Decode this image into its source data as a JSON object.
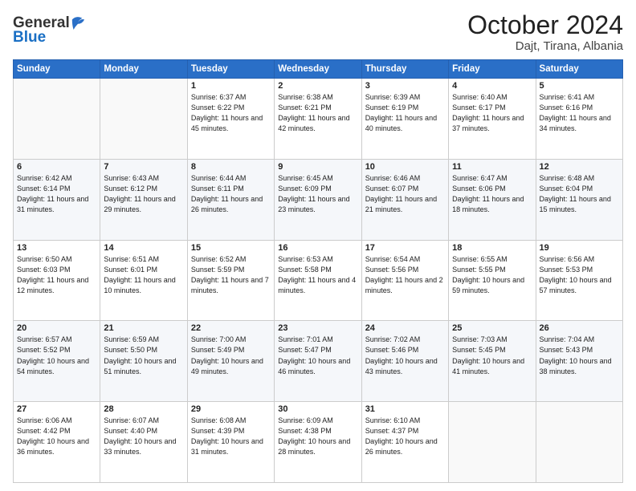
{
  "header": {
    "logo_general": "General",
    "logo_blue": "Blue",
    "month_title": "October 2024",
    "location": "Dajt, Tirana, Albania"
  },
  "weekdays": [
    "Sunday",
    "Monday",
    "Tuesday",
    "Wednesday",
    "Thursday",
    "Friday",
    "Saturday"
  ],
  "weeks": [
    [
      {
        "day": "",
        "sunrise": "",
        "sunset": "",
        "daylight": ""
      },
      {
        "day": "",
        "sunrise": "",
        "sunset": "",
        "daylight": ""
      },
      {
        "day": "1",
        "sunrise": "Sunrise: 6:37 AM",
        "sunset": "Sunset: 6:22 PM",
        "daylight": "Daylight: 11 hours and 45 minutes."
      },
      {
        "day": "2",
        "sunrise": "Sunrise: 6:38 AM",
        "sunset": "Sunset: 6:21 PM",
        "daylight": "Daylight: 11 hours and 42 minutes."
      },
      {
        "day": "3",
        "sunrise": "Sunrise: 6:39 AM",
        "sunset": "Sunset: 6:19 PM",
        "daylight": "Daylight: 11 hours and 40 minutes."
      },
      {
        "day": "4",
        "sunrise": "Sunrise: 6:40 AM",
        "sunset": "Sunset: 6:17 PM",
        "daylight": "Daylight: 11 hours and 37 minutes."
      },
      {
        "day": "5",
        "sunrise": "Sunrise: 6:41 AM",
        "sunset": "Sunset: 6:16 PM",
        "daylight": "Daylight: 11 hours and 34 minutes."
      }
    ],
    [
      {
        "day": "6",
        "sunrise": "Sunrise: 6:42 AM",
        "sunset": "Sunset: 6:14 PM",
        "daylight": "Daylight: 11 hours and 31 minutes."
      },
      {
        "day": "7",
        "sunrise": "Sunrise: 6:43 AM",
        "sunset": "Sunset: 6:12 PM",
        "daylight": "Daylight: 11 hours and 29 minutes."
      },
      {
        "day": "8",
        "sunrise": "Sunrise: 6:44 AM",
        "sunset": "Sunset: 6:11 PM",
        "daylight": "Daylight: 11 hours and 26 minutes."
      },
      {
        "day": "9",
        "sunrise": "Sunrise: 6:45 AM",
        "sunset": "Sunset: 6:09 PM",
        "daylight": "Daylight: 11 hours and 23 minutes."
      },
      {
        "day": "10",
        "sunrise": "Sunrise: 6:46 AM",
        "sunset": "Sunset: 6:07 PM",
        "daylight": "Daylight: 11 hours and 21 minutes."
      },
      {
        "day": "11",
        "sunrise": "Sunrise: 6:47 AM",
        "sunset": "Sunset: 6:06 PM",
        "daylight": "Daylight: 11 hours and 18 minutes."
      },
      {
        "day": "12",
        "sunrise": "Sunrise: 6:48 AM",
        "sunset": "Sunset: 6:04 PM",
        "daylight": "Daylight: 11 hours and 15 minutes."
      }
    ],
    [
      {
        "day": "13",
        "sunrise": "Sunrise: 6:50 AM",
        "sunset": "Sunset: 6:03 PM",
        "daylight": "Daylight: 11 hours and 12 minutes."
      },
      {
        "day": "14",
        "sunrise": "Sunrise: 6:51 AM",
        "sunset": "Sunset: 6:01 PM",
        "daylight": "Daylight: 11 hours and 10 minutes."
      },
      {
        "day": "15",
        "sunrise": "Sunrise: 6:52 AM",
        "sunset": "Sunset: 5:59 PM",
        "daylight": "Daylight: 11 hours and 7 minutes."
      },
      {
        "day": "16",
        "sunrise": "Sunrise: 6:53 AM",
        "sunset": "Sunset: 5:58 PM",
        "daylight": "Daylight: 11 hours and 4 minutes."
      },
      {
        "day": "17",
        "sunrise": "Sunrise: 6:54 AM",
        "sunset": "Sunset: 5:56 PM",
        "daylight": "Daylight: 11 hours and 2 minutes."
      },
      {
        "day": "18",
        "sunrise": "Sunrise: 6:55 AM",
        "sunset": "Sunset: 5:55 PM",
        "daylight": "Daylight: 10 hours and 59 minutes."
      },
      {
        "day": "19",
        "sunrise": "Sunrise: 6:56 AM",
        "sunset": "Sunset: 5:53 PM",
        "daylight": "Daylight: 10 hours and 57 minutes."
      }
    ],
    [
      {
        "day": "20",
        "sunrise": "Sunrise: 6:57 AM",
        "sunset": "Sunset: 5:52 PM",
        "daylight": "Daylight: 10 hours and 54 minutes."
      },
      {
        "day": "21",
        "sunrise": "Sunrise: 6:59 AM",
        "sunset": "Sunset: 5:50 PM",
        "daylight": "Daylight: 10 hours and 51 minutes."
      },
      {
        "day": "22",
        "sunrise": "Sunrise: 7:00 AM",
        "sunset": "Sunset: 5:49 PM",
        "daylight": "Daylight: 10 hours and 49 minutes."
      },
      {
        "day": "23",
        "sunrise": "Sunrise: 7:01 AM",
        "sunset": "Sunset: 5:47 PM",
        "daylight": "Daylight: 10 hours and 46 minutes."
      },
      {
        "day": "24",
        "sunrise": "Sunrise: 7:02 AM",
        "sunset": "Sunset: 5:46 PM",
        "daylight": "Daylight: 10 hours and 43 minutes."
      },
      {
        "day": "25",
        "sunrise": "Sunrise: 7:03 AM",
        "sunset": "Sunset: 5:45 PM",
        "daylight": "Daylight: 10 hours and 41 minutes."
      },
      {
        "day": "26",
        "sunrise": "Sunrise: 7:04 AM",
        "sunset": "Sunset: 5:43 PM",
        "daylight": "Daylight: 10 hours and 38 minutes."
      }
    ],
    [
      {
        "day": "27",
        "sunrise": "Sunrise: 6:06 AM",
        "sunset": "Sunset: 4:42 PM",
        "daylight": "Daylight: 10 hours and 36 minutes."
      },
      {
        "day": "28",
        "sunrise": "Sunrise: 6:07 AM",
        "sunset": "Sunset: 4:40 PM",
        "daylight": "Daylight: 10 hours and 33 minutes."
      },
      {
        "day": "29",
        "sunrise": "Sunrise: 6:08 AM",
        "sunset": "Sunset: 4:39 PM",
        "daylight": "Daylight: 10 hours and 31 minutes."
      },
      {
        "day": "30",
        "sunrise": "Sunrise: 6:09 AM",
        "sunset": "Sunset: 4:38 PM",
        "daylight": "Daylight: 10 hours and 28 minutes."
      },
      {
        "day": "31",
        "sunrise": "Sunrise: 6:10 AM",
        "sunset": "Sunset: 4:37 PM",
        "daylight": "Daylight: 10 hours and 26 minutes."
      },
      {
        "day": "",
        "sunrise": "",
        "sunset": "",
        "daylight": ""
      },
      {
        "day": "",
        "sunrise": "",
        "sunset": "",
        "daylight": ""
      }
    ]
  ]
}
